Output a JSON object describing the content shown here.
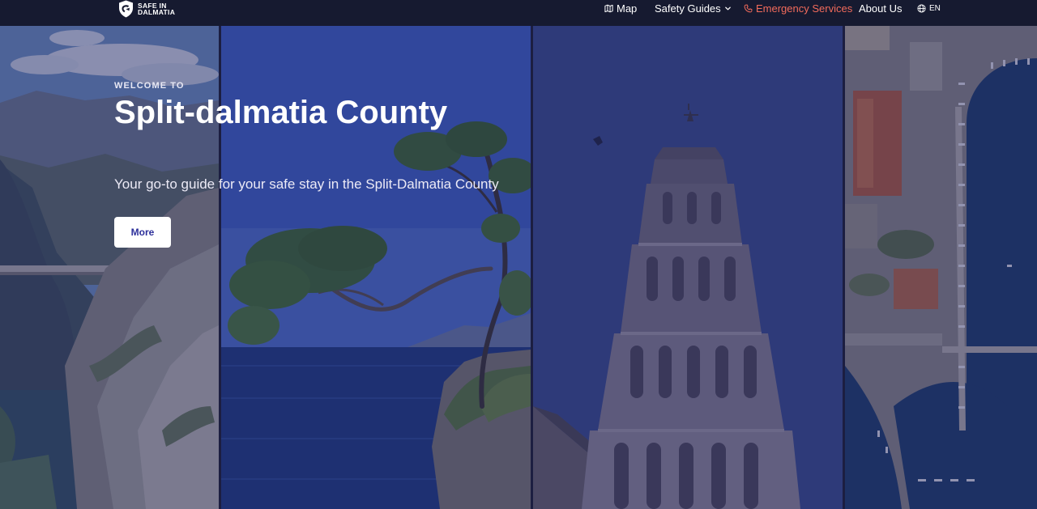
{
  "brand": {
    "line1": "SAFE IN",
    "line2": "DALMATIA"
  },
  "nav": {
    "map": "Map",
    "safety_guides": "Safety Guides",
    "emergency_services": "Emergency Services",
    "about_us": "About Us",
    "language": "EN"
  },
  "hero": {
    "eyebrow": "WELCOME TO",
    "title": "Split-dalmatia County",
    "subtitle": "Your go-to guide for your safe stay in the Split-Dalmatia County",
    "button": "More"
  },
  "colors": {
    "nav_bg": "#161a30",
    "emergency": "#f26b5b",
    "button_text": "#2c2f9a",
    "overlay": "#1e2260"
  },
  "icons": {
    "map": "map-icon",
    "dropdown": "chevron-down-icon",
    "phone": "phone-icon",
    "language": "globe-icon",
    "logo": "shield-logo-icon"
  }
}
